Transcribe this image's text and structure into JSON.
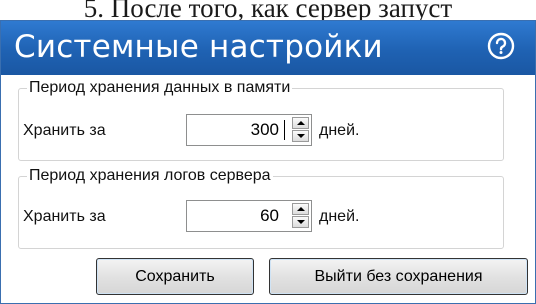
{
  "document": {
    "step_text": "5. После того, как сервер запуст"
  },
  "dialog": {
    "title": "Системные настройки",
    "help_icon": "question-circle-icon",
    "memory_group": {
      "legend": "Период хранения данных в памяти",
      "label": "Хранить за",
      "value": "300",
      "unit": "дней."
    },
    "logs_group": {
      "legend": "Период хранения логов сервера",
      "label": "Хранить за",
      "value": "60",
      "unit": "дней."
    },
    "buttons": {
      "save": "Сохранить",
      "exit_without_save": "Выйти без сохранения"
    }
  },
  "colors": {
    "titlebar": "#1f62b3",
    "dialog_border": "#3a6fb0",
    "button_border": "#333333"
  }
}
